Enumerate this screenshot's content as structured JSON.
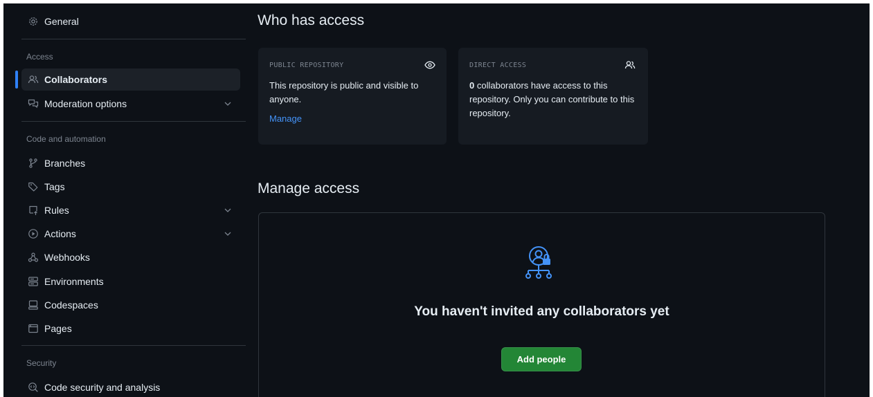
{
  "sidebar": {
    "general": {
      "label": "General",
      "icon": "gear-icon"
    },
    "access_section": "Access",
    "collaborators": {
      "label": "Collaborators",
      "icon": "people-icon",
      "active": true
    },
    "moderation": {
      "label": "Moderation options",
      "icon": "comment-discussion-icon"
    },
    "code_section": "Code and automation",
    "branches": {
      "label": "Branches",
      "icon": "git-branch-icon"
    },
    "tags": {
      "label": "Tags",
      "icon": "tag-icon"
    },
    "rules": {
      "label": "Rules",
      "icon": "repo-push-icon"
    },
    "actions": {
      "label": "Actions",
      "icon": "play-icon"
    },
    "webhooks": {
      "label": "Webhooks",
      "icon": "webhook-icon"
    },
    "environments": {
      "label": "Environments",
      "icon": "server-icon"
    },
    "codespaces": {
      "label": "Codespaces",
      "icon": "codespaces-icon"
    },
    "pages": {
      "label": "Pages",
      "icon": "browser-icon"
    },
    "security_section": "Security",
    "code_security": {
      "label": "Code security and analysis",
      "icon": "codescan-icon"
    }
  },
  "who_has_access": {
    "title": "Who has access",
    "public_card": {
      "label": "PUBLIC REPOSITORY",
      "text": "This repository is public and visible to anyone.",
      "link": "Manage",
      "icon": "eye-icon"
    },
    "direct_card": {
      "label": "DIRECT ACCESS",
      "count": "0",
      "text": " collaborators have access to this repository. Only you can contribute to this repository.",
      "icon": "people-icon"
    }
  },
  "manage_access": {
    "title": "Manage access",
    "blankslate_title": "You haven't invited any collaborators yet",
    "add_button": "Add people",
    "illustration": "person-lock-network-icon"
  },
  "colors": {
    "background": "#0d1117",
    "card": "#161b22",
    "accent": "#2f81f7",
    "link": "#4493f8",
    "primary_button": "#238636"
  }
}
